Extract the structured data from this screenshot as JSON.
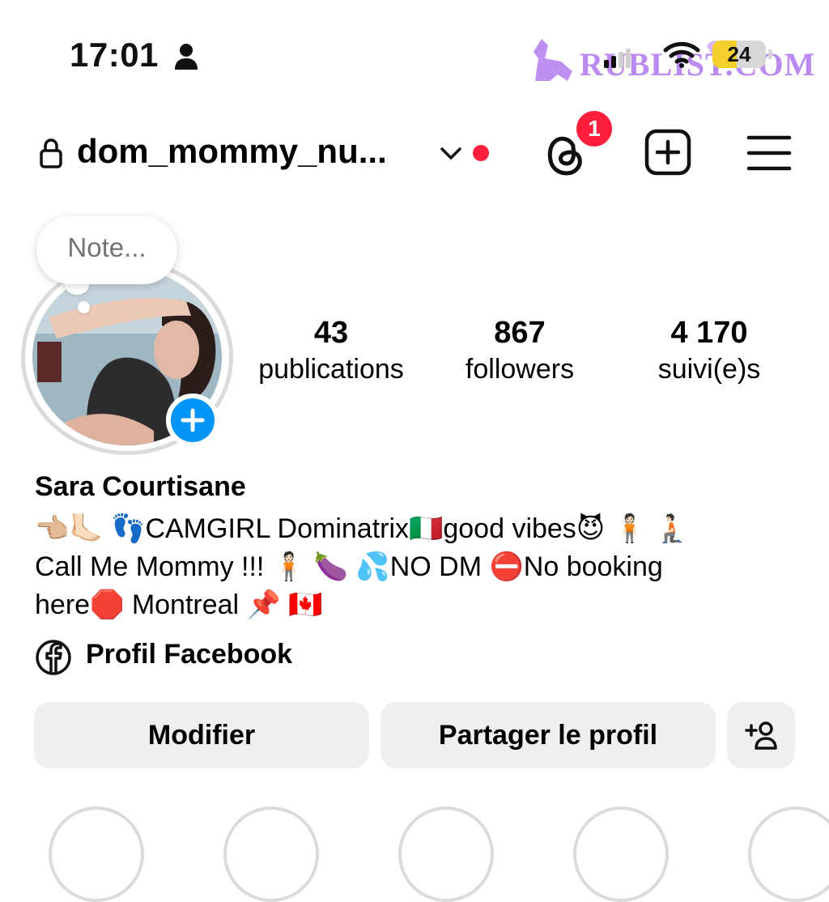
{
  "status_bar": {
    "time": "17:01",
    "battery": "24",
    "watermark": "RUBLIST.COM"
  },
  "header": {
    "username": "dom_mommy_nu...",
    "threads_badge": "1"
  },
  "profile": {
    "note_placeholder": "Note...",
    "stats": [
      {
        "value": "43",
        "label": "publications"
      },
      {
        "value": "867",
        "label": "followers"
      },
      {
        "value": "4 170",
        "label": "suivi(e)s"
      }
    ],
    "name": "Sara Courtisane",
    "bio_lines": [
      "👈🏼🦶🏻 👣CAMGIRL Dominatrix🇮🇹good vibes😈 🧍🏻 🧎🏻",
      "Call Me Mommy !!! 🧍🏻 🍆 💦NO DM ⛔No booking",
      "here🛑 Montreal 📌 🇨🇦"
    ],
    "facebook_link": "Profil Facebook"
  },
  "actions": {
    "edit": "Modifier",
    "share": "Partager le profil"
  },
  "colors": {
    "accent_blue": "#0095f6",
    "notification_red": "#ff1f3d",
    "button_bg": "#efefef",
    "watermark_purple": "#b784f0"
  }
}
